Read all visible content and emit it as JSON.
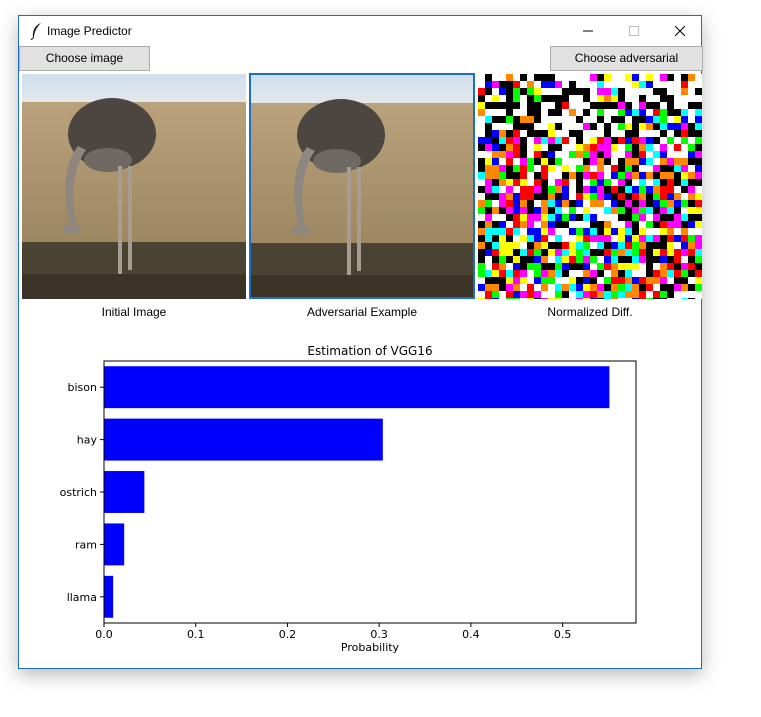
{
  "window": {
    "title": "Image Predictor",
    "app_icon": "feather-icon"
  },
  "toolbar": {
    "choose_image_label": "Choose image",
    "choose_adversarial_label": "Choose adversarial"
  },
  "panels": [
    {
      "caption": "Initial Image"
    },
    {
      "caption": "Adversarial Example"
    },
    {
      "caption": "Normalized Diff."
    }
  ],
  "colors": {
    "bar": "#0000ff",
    "selection_border": "#1f6fbf"
  },
  "chart_data": {
    "type": "bar",
    "orientation": "horizontal",
    "title": "Estimation of VGG16",
    "xlabel": "Probability",
    "ylabel": "",
    "categories": [
      "bison",
      "hay",
      "ostrich",
      "ram",
      "llama"
    ],
    "values": [
      0.551,
      0.304,
      0.044,
      0.022,
      0.01
    ],
    "xlim": [
      0,
      0.58
    ],
    "xticks": [
      0,
      0.1,
      0.2,
      0.3,
      0.4,
      0.5
    ],
    "xtick_labels": [
      "0.0",
      "0.1",
      "0.2",
      "0.3",
      "0.4",
      "0.5"
    ],
    "grid": false,
    "color": "#0000ff"
  }
}
